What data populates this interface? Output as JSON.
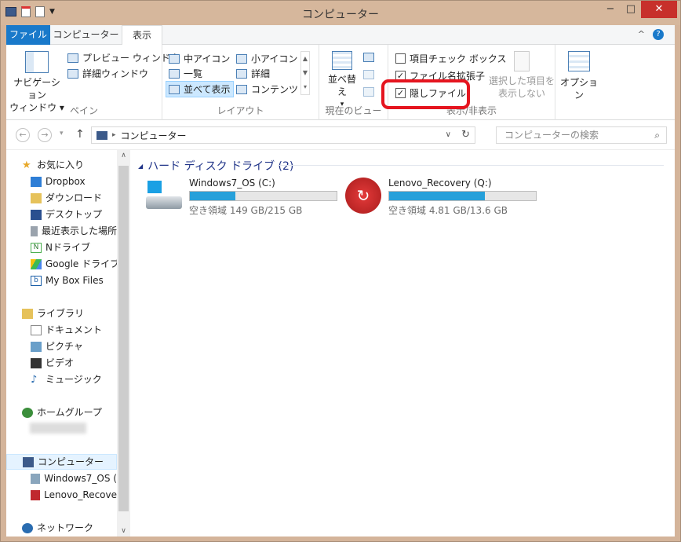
{
  "window": {
    "title": "コンピューター"
  },
  "tabs": {
    "file": "ファイル",
    "computer": "コンピューター",
    "view": "表示"
  },
  "ribbon": {
    "pane": {
      "nav_label": "ナビゲーション",
      "nav_label2": "ウィンドウ",
      "preview": "プレビュー ウィンドウ",
      "details": "詳細ウィンドウ",
      "group": "ペイン"
    },
    "layout": {
      "medium": "中アイコン",
      "small": "小アイコン",
      "list": "一覧",
      "details": "詳細",
      "tiles": "並べて表示",
      "content": "コンテンツ",
      "group": "レイアウト"
    },
    "current": {
      "sort": "並べ替え",
      "group": "現在のビュー"
    },
    "showhide": {
      "checkboxes": "項目チェック ボックス",
      "ext": "ファイル名拡張子",
      "hidden": "隠しファイル",
      "hide_sel": "選択した項目を",
      "hide_sel2": "表示しない",
      "group": "表示/非表示"
    },
    "options": "オプション"
  },
  "address": {
    "path": "コンピューター",
    "search_placeholder": "コンピューターの検索"
  },
  "nav": {
    "favorites": "お気に入り",
    "dropbox": "Dropbox",
    "download": "ダウンロード",
    "desktop": "デスクトップ",
    "recent": "最近表示した場所",
    "ndrive": "Nドライブ",
    "gdrive": "Google ドライブ",
    "mybox": "My Box Files",
    "libraries": "ライブラリ",
    "docs": "ドキュメント",
    "pics": "ピクチャ",
    "video": "ビデオ",
    "music": "ミュージック",
    "homegroup": "ホームグループ",
    "computer": "コンピューター",
    "win7": "Windows7_OS (",
    "lenovo": "Lenovo_Recove",
    "network": "ネットワーク"
  },
  "content": {
    "group_title": "ハード ディスク ドライブ (2)",
    "drives": [
      {
        "name": "Windows7_OS (C:)",
        "free": "空き領域 149 GB/215 GB",
        "used_fraction": 0.31
      },
      {
        "name": "Lenovo_Recovery (Q:)",
        "free": "空き領域 4.81 GB/13.6 GB",
        "used_fraction": 0.65
      }
    ]
  },
  "colors": {
    "accent": "#1979ca",
    "highlight": "#e5151f",
    "bar": "#26a0da"
  }
}
